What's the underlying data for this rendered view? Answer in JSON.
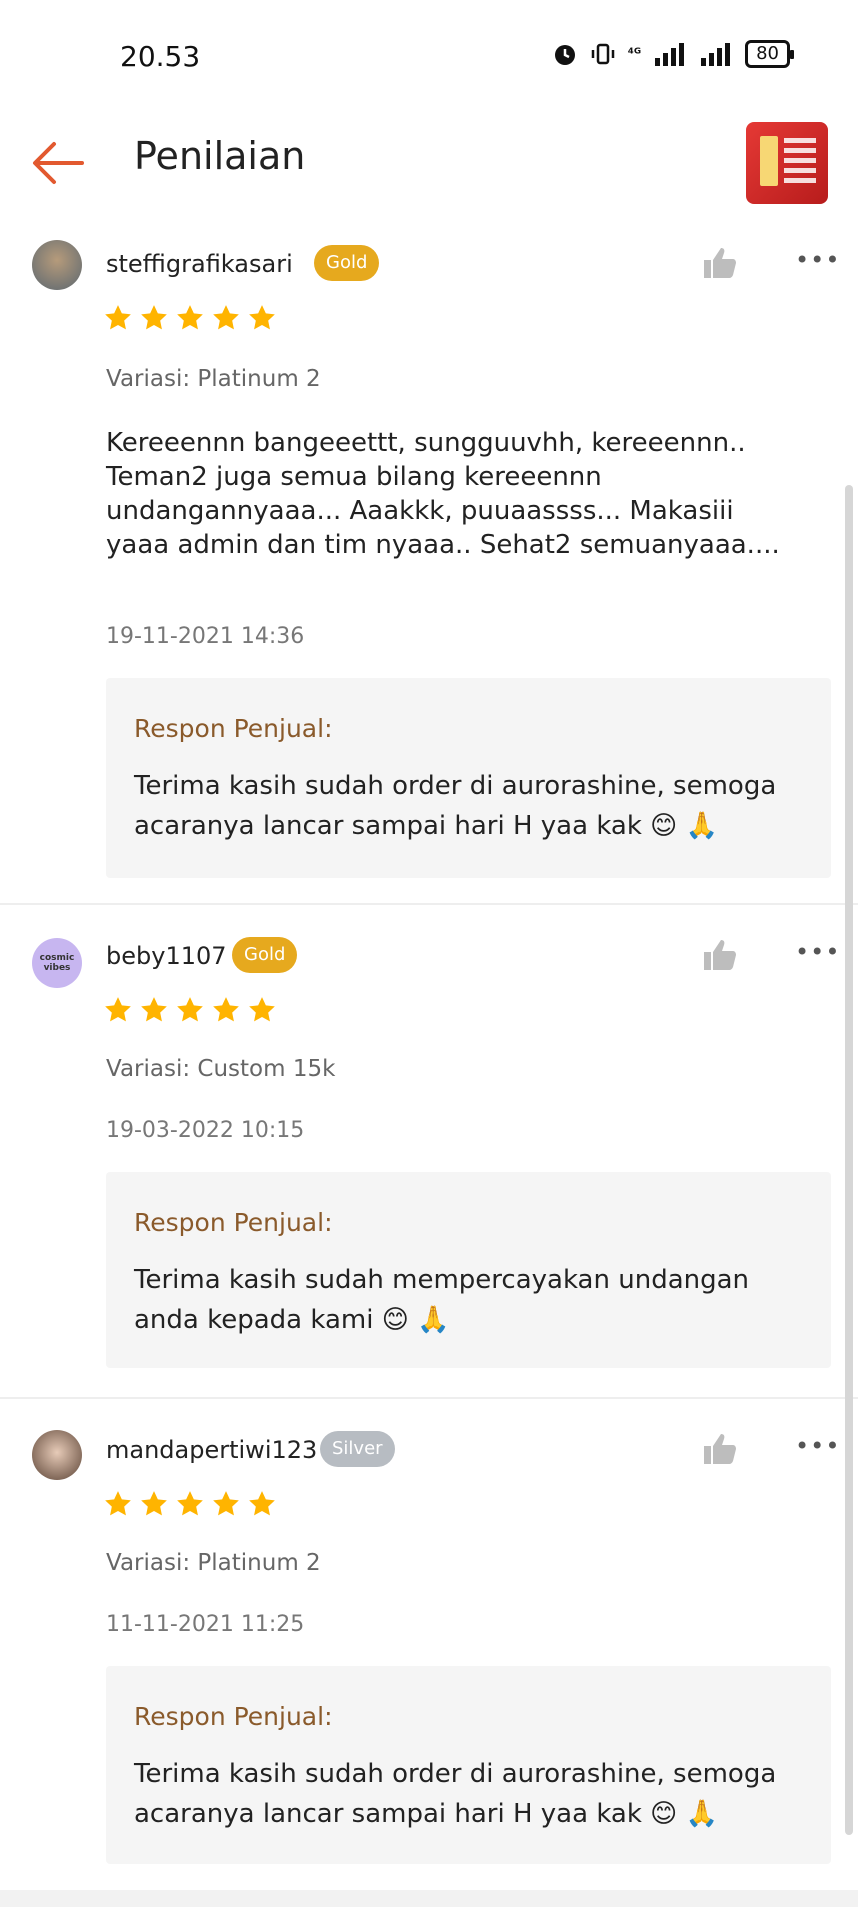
{
  "status_bar": {
    "time": "20.53",
    "network": "⁴ᴳ",
    "battery": "80"
  },
  "header": {
    "title": "Penilaian"
  },
  "colors": {
    "accent": "#e2592f",
    "gold_badge": "#e6a91e",
    "silver_badge": "#b7bcc2",
    "star": "#ffb400",
    "response_title": "#8a5a2b"
  },
  "reviews": [
    {
      "username": "steffigrafikasari",
      "badge": "Gold",
      "rating": 5,
      "variasi": "Variasi: Platinum 2",
      "comment": "Kereeennn bangeeettt, sungguuvhh, kereeennn.. Teman2 juga semua bilang kereeennn undangannyaaa... Aaakkk, puuaassss... Makasiii yaaa admin dan tim nyaaa.. Sehat2 semuanyaaa....",
      "date": "19-11-2021 14:36",
      "response_title": "Respon Penjual:",
      "response_text": "Terima kasih sudah order di aurorashine, semoga acaranya lancar sampai hari H yaa kak 😊 🙏"
    },
    {
      "username": "beby1107",
      "badge": "Gold",
      "rating": 5,
      "variasi": "Variasi: Custom 15k",
      "comment": "",
      "date": "19-03-2022 10:15",
      "response_title": "Respon Penjual:",
      "response_text": "Terima kasih sudah mempercayakan undangan anda kepada kami 😊 🙏"
    },
    {
      "username": "mandapertiwi123",
      "badge": "Silver",
      "rating": 5,
      "variasi": "Variasi: Platinum 2",
      "comment": "",
      "date": "11-11-2021 11:25",
      "response_title": "Respon Penjual:",
      "response_text": "Terima kasih sudah order di aurorashine, semoga acaranya lancar sampai hari H yaa kak 😊 🙏"
    }
  ]
}
